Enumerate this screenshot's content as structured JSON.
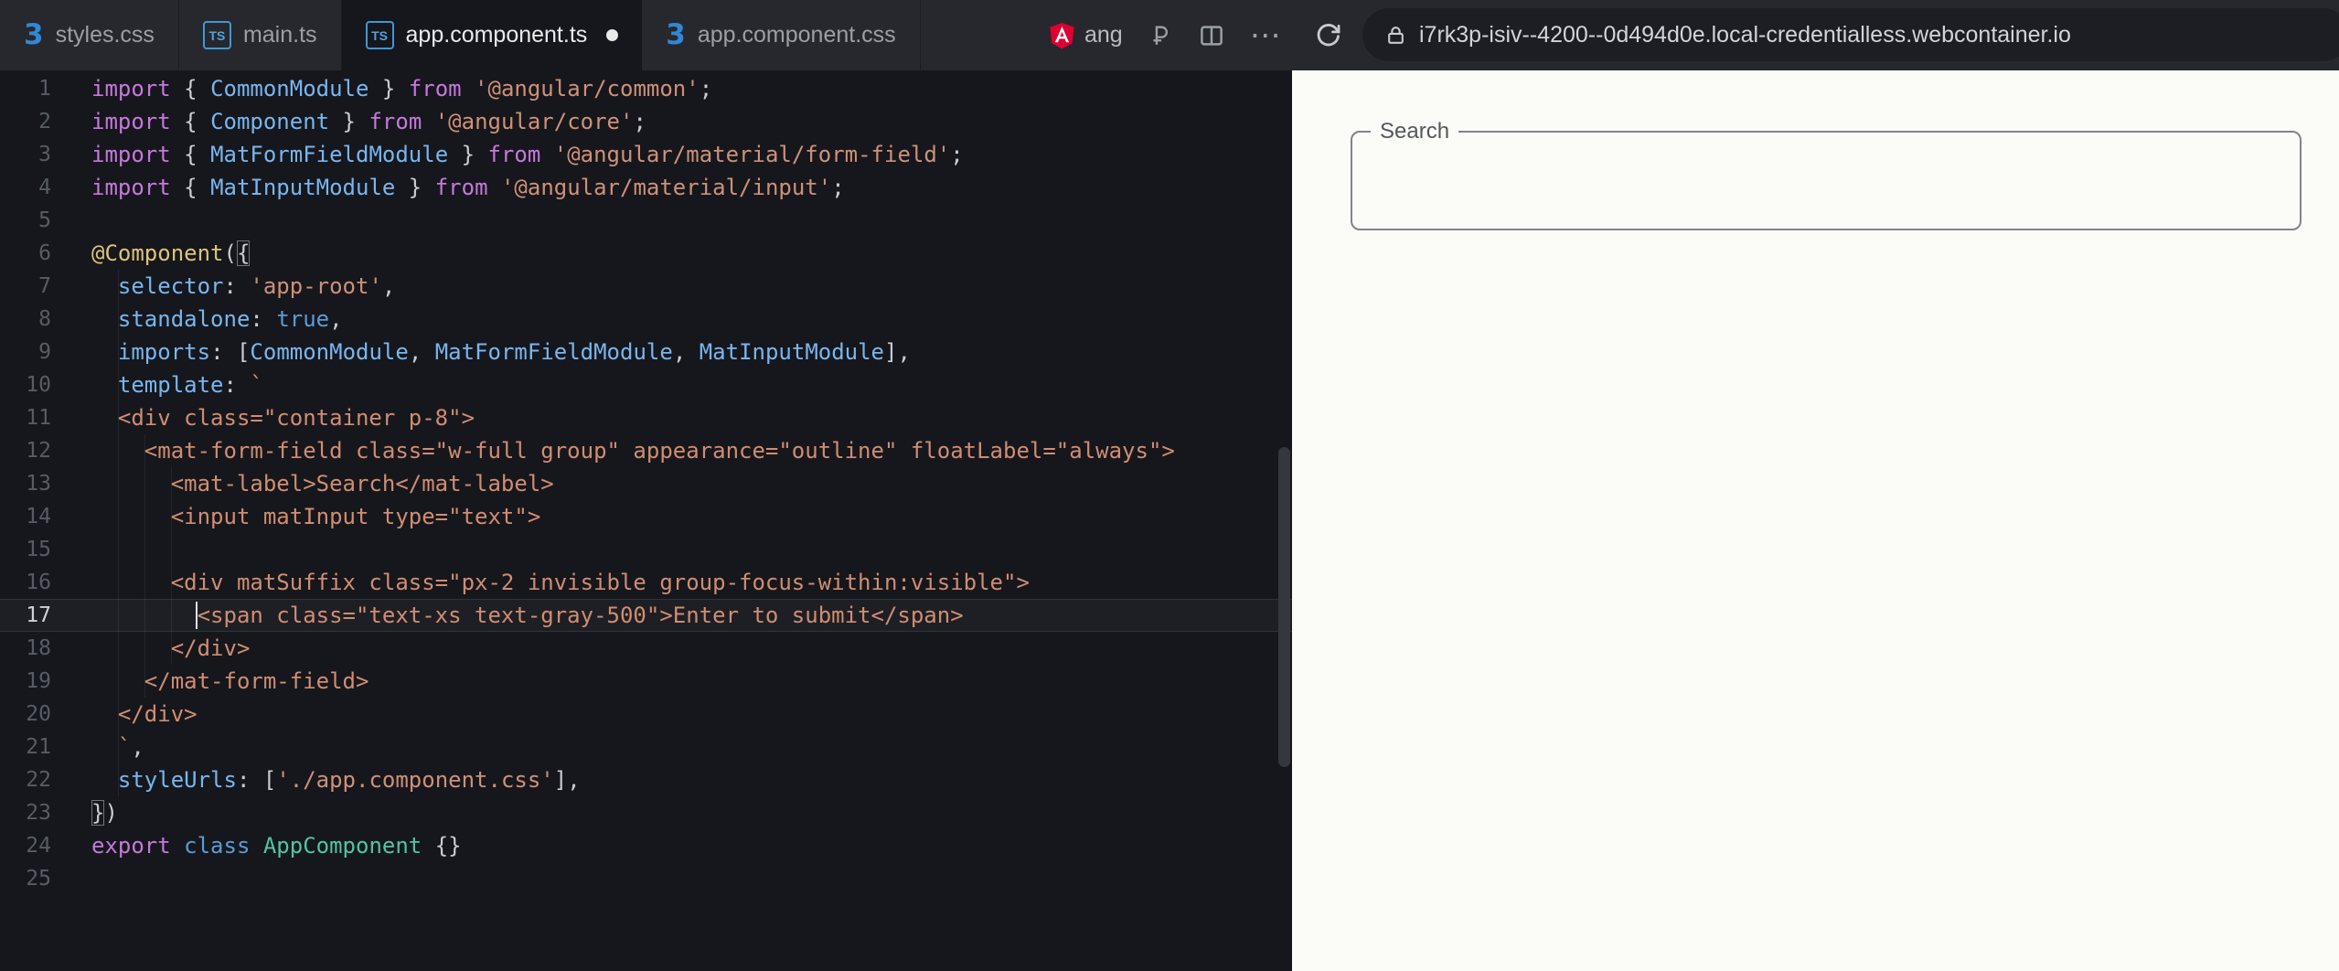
{
  "topbar": {
    "tabs": [
      {
        "label": "styles.css",
        "icon": "css",
        "active": false,
        "unsaved": false
      },
      {
        "label": "main.ts",
        "icon": "ts",
        "active": false,
        "unsaved": false
      },
      {
        "label": "app.component.ts",
        "icon": "ts",
        "active": true,
        "unsaved": true
      },
      {
        "label": "app.component.css",
        "icon": "css",
        "active": false,
        "unsaved": false
      }
    ],
    "project_label": "ang",
    "url": "i7rk3p-isiv--4200--0d494d0e.local-credentialless.webcontainer.io"
  },
  "colors": {
    "topbar_bg": "#27282d",
    "editor_bg": "#16171c",
    "preview_bg": "#fbfbf8",
    "keyword": "#c678dd",
    "identifier": "#78b6f0",
    "string": "#ce9178",
    "template_html": "#d08d72",
    "decorator": "#dcc47b",
    "class_name": "#52c3a5",
    "angular_red": "#dd0031",
    "ts_blue": "#3f97d8"
  },
  "editor": {
    "lines": [
      {
        "n": 1,
        "t": [
          [
            "kw",
            "import"
          ],
          [
            "pun",
            " { "
          ],
          [
            "ent",
            "CommonModule"
          ],
          [
            "pun",
            " } "
          ],
          [
            "kw",
            "from"
          ],
          [
            "str",
            " '@angular/common'"
          ],
          [
            "pun",
            ";"
          ]
        ]
      },
      {
        "n": 2,
        "t": [
          [
            "kw",
            "import"
          ],
          [
            "pun",
            " { "
          ],
          [
            "ent",
            "Component"
          ],
          [
            "pun",
            " } "
          ],
          [
            "kw",
            "from"
          ],
          [
            "str",
            " '@angular/core'"
          ],
          [
            "pun",
            ";"
          ]
        ]
      },
      {
        "n": 3,
        "t": [
          [
            "kw",
            "import"
          ],
          [
            "pun",
            " { "
          ],
          [
            "ent",
            "MatFormFieldModule"
          ],
          [
            "pun",
            " } "
          ],
          [
            "kw",
            "from"
          ],
          [
            "str",
            " '@angular/material/form-field'"
          ],
          [
            "pun",
            ";"
          ]
        ]
      },
      {
        "n": 4,
        "t": [
          [
            "kw",
            "import"
          ],
          [
            "pun",
            " { "
          ],
          [
            "ent",
            "MatInputModule"
          ],
          [
            "pun",
            " } "
          ],
          [
            "kw",
            "from"
          ],
          [
            "str",
            " '@angular/material/input'"
          ],
          [
            "pun",
            ";"
          ]
        ]
      },
      {
        "n": 5,
        "t": []
      },
      {
        "n": 6,
        "t": [
          [
            "deco",
            "@Component"
          ],
          [
            "pun",
            "("
          ],
          [
            "bm",
            "{"
          ]
        ]
      },
      {
        "n": 7,
        "t": [
          [
            "pun",
            "  "
          ],
          [
            "ent",
            "selector"
          ],
          [
            "pun",
            ": "
          ],
          [
            "str",
            "'app-root'"
          ],
          [
            "pun",
            ","
          ]
        ]
      },
      {
        "n": 8,
        "t": [
          [
            "pun",
            "  "
          ],
          [
            "ent",
            "standalone"
          ],
          [
            "pun",
            ": "
          ],
          [
            "kw2",
            "true"
          ],
          [
            "pun",
            ","
          ]
        ]
      },
      {
        "n": 9,
        "t": [
          [
            "pun",
            "  "
          ],
          [
            "ent",
            "imports"
          ],
          [
            "pun",
            ": ["
          ],
          [
            "ent",
            "CommonModule"
          ],
          [
            "pun",
            ", "
          ],
          [
            "ent",
            "MatFormFieldModule"
          ],
          [
            "pun",
            ", "
          ],
          [
            "ent",
            "MatInputModule"
          ],
          [
            "pun",
            "],"
          ]
        ]
      },
      {
        "n": 10,
        "t": [
          [
            "pun",
            "  "
          ],
          [
            "ent",
            "template"
          ],
          [
            "pun",
            ": "
          ],
          [
            "str",
            "`"
          ]
        ]
      },
      {
        "n": 11,
        "t": [
          [
            "html",
            "  <div class=\"container p-8\">"
          ]
        ]
      },
      {
        "n": 12,
        "t": [
          [
            "html",
            "    <mat-form-field class=\"w-full group\" appearance=\"outline\" floatLabel=\"always\">"
          ]
        ]
      },
      {
        "n": 13,
        "t": [
          [
            "html",
            "      <mat-label>Search</mat-label>"
          ]
        ]
      },
      {
        "n": 14,
        "t": [
          [
            "html",
            "      <input matInput type=\"text\">"
          ]
        ]
      },
      {
        "n": 15,
        "t": []
      },
      {
        "n": 16,
        "t": [
          [
            "html",
            "      <div matSuffix class=\"px-2 invisible group-focus-within:visible\">"
          ]
        ]
      },
      {
        "n": 17,
        "cur": true,
        "t": [
          [
            "html",
            "        <span class=\"text-xs text-gray-500\">Enter to submit</span>"
          ]
        ]
      },
      {
        "n": 18,
        "t": [
          [
            "html",
            "      </div>"
          ]
        ]
      },
      {
        "n": 19,
        "t": [
          [
            "html",
            "    </mat-form-field>"
          ]
        ]
      },
      {
        "n": 20,
        "t": [
          [
            "html",
            "  </div>"
          ]
        ]
      },
      {
        "n": 21,
        "t": [
          [
            "str",
            "  `"
          ],
          [
            "pun",
            ","
          ]
        ]
      },
      {
        "n": 22,
        "t": [
          [
            "pun",
            "  "
          ],
          [
            "ent",
            "styleUrls"
          ],
          [
            "pun",
            ": ["
          ],
          [
            "str",
            "'./app.component.css'"
          ],
          [
            "pun",
            "],"
          ]
        ]
      },
      {
        "n": 23,
        "t": [
          [
            "bm",
            "}"
          ],
          [
            "pun",
            ")"
          ]
        ]
      },
      {
        "n": 24,
        "t": [
          [
            "kw",
            "export"
          ],
          [
            "pun",
            " "
          ],
          [
            "kw2",
            "class"
          ],
          [
            "pun",
            " "
          ],
          [
            "cls",
            "AppComponent"
          ],
          [
            "pun",
            " {}"
          ]
        ]
      },
      {
        "n": 25,
        "t": []
      }
    ]
  },
  "preview": {
    "search_label": "Search"
  }
}
